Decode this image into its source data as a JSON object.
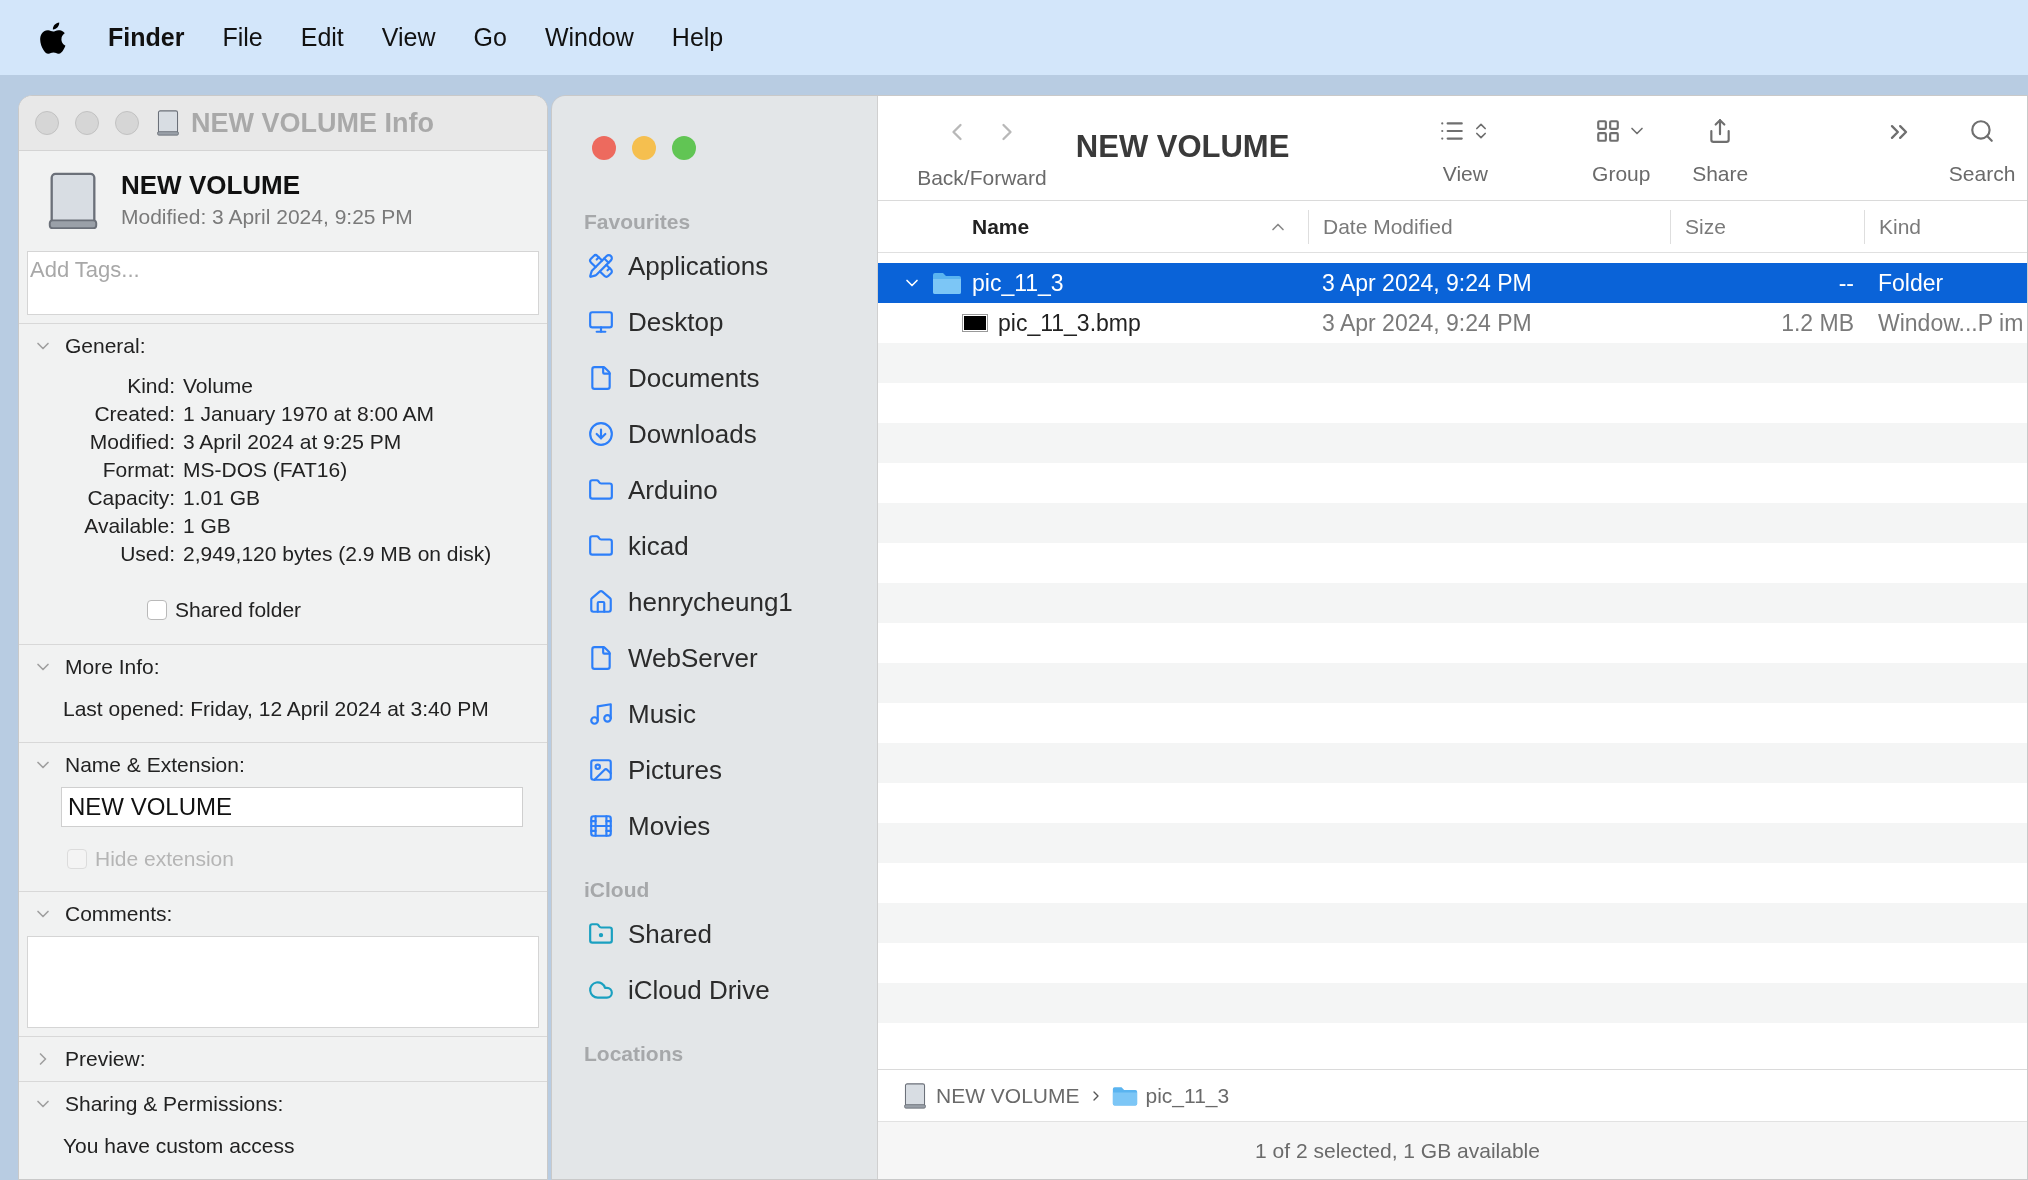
{
  "menu_bar": {
    "app": "Finder",
    "items": [
      "File",
      "Edit",
      "View",
      "Go",
      "Window",
      "Help"
    ]
  },
  "info_window": {
    "title": "NEW VOLUME Info",
    "name": "NEW VOLUME",
    "modified": "Modified: 3 April 2024, 9:25 PM",
    "tags": {
      "placeholder": "Add Tags..."
    },
    "sections": [
      {
        "kind": "general",
        "title": "General:",
        "expanded": true,
        "rows": [
          {
            "label": "Kind:",
            "value": "Volume"
          },
          {
            "label": "Created:",
            "value": "1 January 1970 at 8:00 AM"
          },
          {
            "label": "Modified:",
            "value": "3 April 2024 at 9:25 PM"
          },
          {
            "label": "Format:",
            "value": "MS-DOS (FAT16)"
          },
          {
            "label": "Capacity:",
            "value": "1.01 GB"
          },
          {
            "label": "Available:",
            "value": "1 GB"
          },
          {
            "label": "Used:",
            "value": "2,949,120 bytes (2.9 MB on disk)"
          }
        ],
        "checkbox": {
          "label": "Shared folder",
          "checked": false,
          "disabled": false
        }
      },
      {
        "kind": "more",
        "title": "More Info:",
        "expanded": true,
        "text": "Last opened: Friday, 12 April 2024 at 3:40 PM"
      },
      {
        "kind": "name",
        "title": "Name & Extension:",
        "expanded": true,
        "value": "NEW VOLUME",
        "checkbox": {
          "label": "Hide extension",
          "checked": false,
          "disabled": true
        }
      },
      {
        "kind": "comments",
        "title": "Comments:",
        "expanded": true
      },
      {
        "title": "Preview:",
        "expanded": false
      },
      {
        "kind": "sharing",
        "title": "Sharing & Permissions:",
        "expanded": true,
        "text": "You have custom access"
      }
    ]
  },
  "finder": {
    "sidebar": [
      {
        "heading": "Favourites",
        "items": [
          {
            "kind": "applications",
            "label": "Applications"
          },
          {
            "kind": "desktop",
            "label": "Desktop"
          },
          {
            "kind": "document",
            "label": "Documents"
          },
          {
            "kind": "downloads",
            "label": "Downloads"
          },
          {
            "kind": "folder",
            "label": "Arduino"
          },
          {
            "kind": "folder",
            "label": "kicad"
          },
          {
            "kind": "home",
            "label": "henrycheung1"
          },
          {
            "kind": "document",
            "label": "WebServer"
          },
          {
            "kind": "music",
            "label": "Music"
          },
          {
            "kind": "pictures",
            "label": "Pictures"
          },
          {
            "kind": "movies",
            "label": "Movies"
          }
        ]
      },
      {
        "heading": "iCloud",
        "items": [
          {
            "kind": "shared",
            "label": "Shared"
          },
          {
            "kind": "cloud",
            "label": "iCloud Drive"
          }
        ]
      },
      {
        "heading": "Locations"
      }
    ],
    "toolbar": {
      "back_forward": "Back/Forward",
      "title": "NEW VOLUME",
      "view": "View",
      "group": "Group",
      "share": "Share",
      "search": "Search"
    },
    "table": {
      "columns": [
        {
          "label": "Name",
          "sorted": true
        },
        {
          "label": "Date Modified",
          "sorted": false
        },
        {
          "label": "Size",
          "sorted": false
        },
        {
          "label": "Kind",
          "sorted": false
        }
      ],
      "rows": [
        {
          "kind": "folder",
          "name": "pic_11_3",
          "date": "3 Apr 2024, 9:24 PM",
          "size": "--",
          "type": "Folder",
          "selected": true,
          "expanded": true,
          "children": [
            {
              "kind": "file",
              "name": "pic_11_3.bmp",
              "date": "3 Apr 2024, 9:24 PM",
              "size": "1.2 MB",
              "type": "Window...P im",
              "selected": false
            }
          ]
        }
      ]
    },
    "path_bar": [
      {
        "kind": "volume",
        "label": "NEW VOLUME"
      },
      {
        "kind": "folder",
        "label": "pic_11_3"
      }
    ],
    "status_bar": "1 of 2 selected, 1 GB available"
  }
}
